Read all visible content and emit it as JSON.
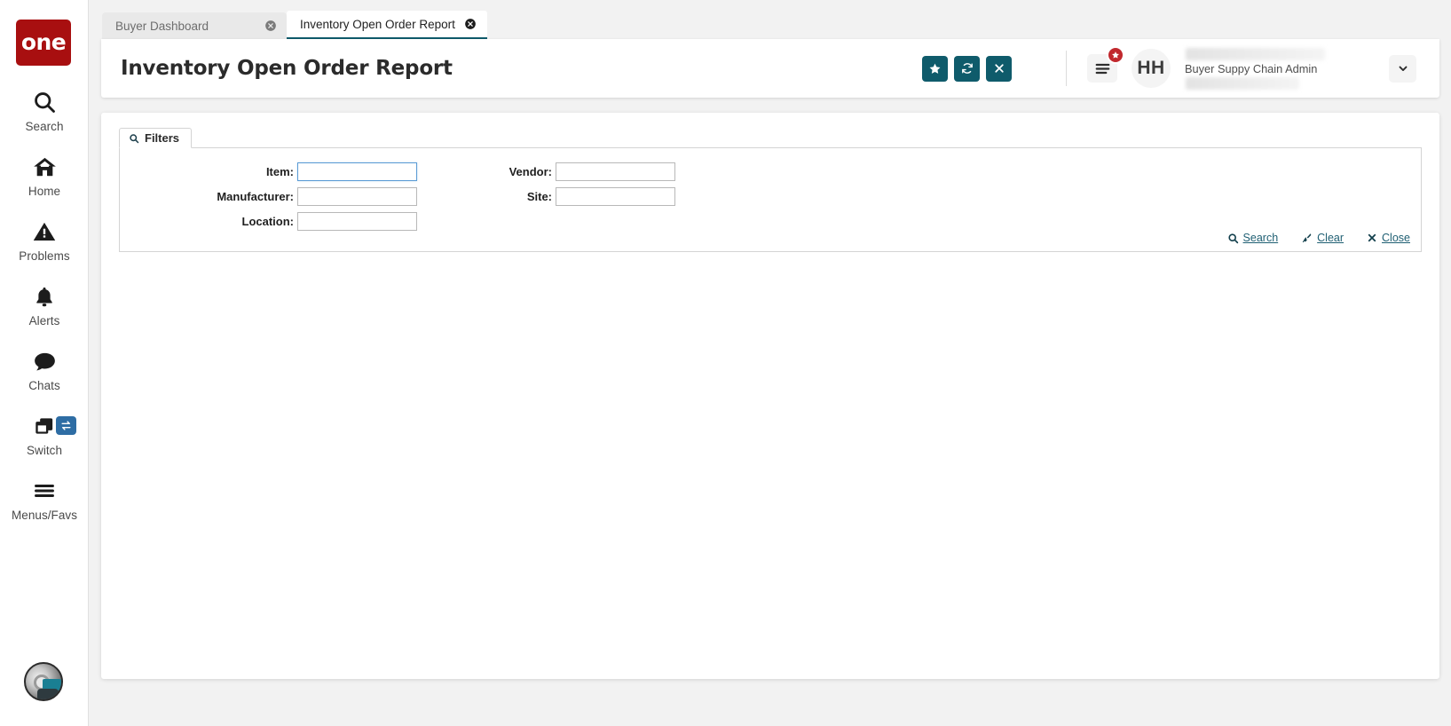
{
  "brand": {
    "logo_text": "one",
    "logo_color": "#a80f10"
  },
  "sidebar": {
    "items": [
      {
        "label": "Search",
        "icon": "search-icon"
      },
      {
        "label": "Home",
        "icon": "home-icon"
      },
      {
        "label": "Problems",
        "icon": "warning-triangle-icon"
      },
      {
        "label": "Alerts",
        "icon": "bell-icon"
      },
      {
        "label": "Chats",
        "icon": "chat-bubble-icon"
      },
      {
        "label": "Switch",
        "icon": "windows-stack-icon",
        "badge_icon": "swap-arrows-icon"
      },
      {
        "label": "Menus/Favs",
        "icon": "hamburger-icon"
      }
    ],
    "assistant": {
      "name": "assistant-orb"
    }
  },
  "tabs": [
    {
      "label": "Buyer Dashboard",
      "active": false,
      "close_icon": "close-circle-icon"
    },
    {
      "label": "Inventory Open Order Report",
      "active": true,
      "close_icon": "close-circle-icon"
    }
  ],
  "header": {
    "title": "Inventory Open Order Report",
    "accent_color": "#0f5b6b",
    "actions": [
      {
        "name": "favorite-button",
        "icon": "star-icon"
      },
      {
        "name": "refresh-button",
        "icon": "refresh-icon"
      },
      {
        "name": "close-button",
        "icon": "x-icon"
      }
    ],
    "menu": {
      "icon": "hamburger-menu-icon",
      "badge_icon": "star-badge-icon",
      "badge_color": "#c1282d"
    },
    "user": {
      "avatar_initials": "HH",
      "role": "Buyer Suppy Chain Admin",
      "caret_icon": "chevron-down-icon"
    }
  },
  "filters": {
    "tab_label": "Filters",
    "tab_icon": "search-icon",
    "fields": [
      {
        "label": "Item:",
        "value": "",
        "placeholder": "",
        "focused": true,
        "name": "item-input"
      },
      {
        "label": "Vendor:",
        "value": "",
        "placeholder": "",
        "focused": false,
        "name": "vendor-input"
      },
      {
        "label": "Manufacturer:",
        "value": "",
        "placeholder": "",
        "focused": false,
        "name": "manufacturer-input"
      },
      {
        "label": "Site:",
        "value": "",
        "placeholder": "",
        "focused": false,
        "name": "site-input"
      },
      {
        "label": "Location:",
        "value": "",
        "placeholder": "",
        "focused": false,
        "name": "location-input"
      }
    ],
    "links": [
      {
        "label": "Search",
        "icon": "search-icon",
        "name": "search-link"
      },
      {
        "label": "Clear",
        "icon": "broom-icon",
        "name": "clear-link"
      },
      {
        "label": "Close",
        "icon": "x-icon",
        "name": "close-link"
      }
    ]
  }
}
